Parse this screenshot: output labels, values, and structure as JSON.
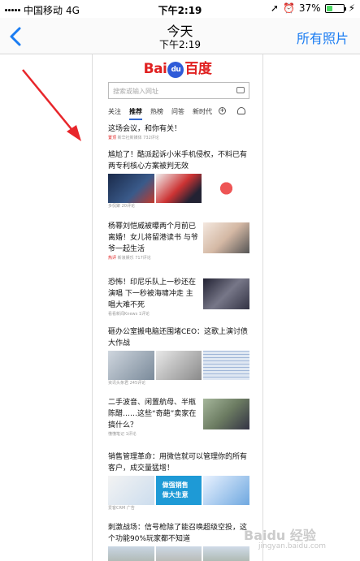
{
  "status_bar": {
    "carrier": "中国移动",
    "network": "4G",
    "time": "下午2:19",
    "battery": "37%"
  },
  "navbar": {
    "back_icon": "chevron-left-icon",
    "title": "今天",
    "subtitle": "下午2:19",
    "all_photos": "所有照片"
  },
  "baidu": {
    "logo_bai": "Bai",
    "logo_du": "du",
    "logo_cn": "百度",
    "search_placeholder": "搜索或输入网址",
    "tabs": [
      "关注",
      "推荐",
      "热榜",
      "问答",
      "新时代"
    ],
    "active_tab": "推荐"
  },
  "articles": [
    {
      "title": "这场会议，和你有关！",
      "tag": "置顶",
      "source": "新华社新媒体",
      "comments": "732评论"
    },
    {
      "title": "尴尬了！酷派起诉小米手机侵权，不料已有两专利核心方案被判无效",
      "source": "多侃聚",
      "comments": "20评论"
    },
    {
      "title": "杨幂刘恺威被曝两个月前已离婚！女儿将留港读书 与爷爷一起生活",
      "tag": "热评",
      "source": "新浪娱乐",
      "comments": "717评论"
    },
    {
      "title": "恐怖！印尼乐队上一秒还在演唱 下一秒被海啸冲走 主唱大难不死",
      "source": "看看新闻Knews",
      "comments": "1评论"
    },
    {
      "title": "砸办公室搬电脑还围堵CEO：这歌上演讨债大作战",
      "source": "资讯头条君",
      "comments": "245评论"
    },
    {
      "title": "二手波音、闲置航母、半瓶陈醋……这些“奇葩”卖家在搞什么？",
      "source": "懂懂笔记",
      "comments": "1评论"
    },
    {
      "title": "销售管理革命：用微信就可以管理你的所有客户，成交量猛增！",
      "source": "爱客CRM",
      "comments": "广告"
    },
    {
      "title": "刺激战场：信号枪除了能召唤超级空投，这个功能90%玩家都不知道",
      "source": "",
      "comments": ""
    }
  ],
  "thumb_texts": {
    "ad_text": "做强销售 做大生意"
  },
  "watermark": {
    "main": "Baidu 经验",
    "sub": "jingyan.baidu.com"
  },
  "colors": {
    "ios_blue": "#1a7cf2",
    "baidu_red": "#e02020",
    "baidu_blue": "#2f5bd8",
    "arrow": "#e8262b"
  }
}
